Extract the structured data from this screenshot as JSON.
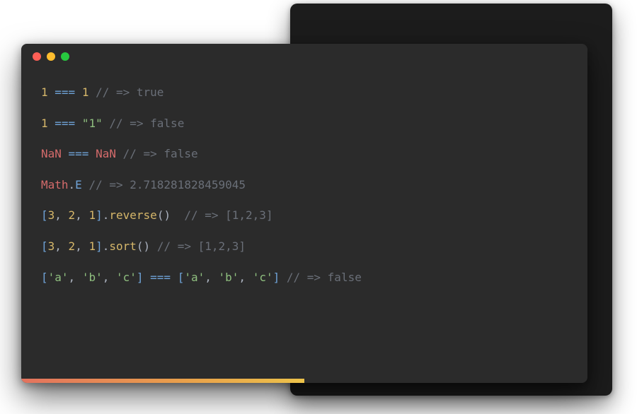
{
  "colors": {
    "editor_bg": "#2b2b2b",
    "back_bg": "#1c1c1c",
    "dot_red": "#ff5f56",
    "dot_yellow": "#ffbd2e",
    "dot_green": "#27c93f"
  },
  "code": {
    "lines": [
      {
        "tokens": [
          {
            "text": "1",
            "cls": "tok-num"
          },
          {
            "text": " === ",
            "cls": "tok-op"
          },
          {
            "text": "1",
            "cls": "tok-num"
          },
          {
            "text": " ",
            "cls": "tok-pun"
          },
          {
            "text": "// => true",
            "cls": "tok-com"
          }
        ]
      },
      {
        "tokens": [
          {
            "text": "1",
            "cls": "tok-num"
          },
          {
            "text": " === ",
            "cls": "tok-op"
          },
          {
            "text": "\"1\"",
            "cls": "tok-str"
          },
          {
            "text": " ",
            "cls": "tok-pun"
          },
          {
            "text": "// => false",
            "cls": "tok-com"
          }
        ]
      },
      {
        "tokens": [
          {
            "text": "NaN",
            "cls": "tok-nan"
          },
          {
            "text": " === ",
            "cls": "tok-op"
          },
          {
            "text": "NaN",
            "cls": "tok-nan"
          },
          {
            "text": " ",
            "cls": "tok-pun"
          },
          {
            "text": "// => false",
            "cls": "tok-com"
          }
        ]
      },
      {
        "tokens": [
          {
            "text": "Math",
            "cls": "tok-obj"
          },
          {
            "text": ".",
            "cls": "tok-pun"
          },
          {
            "text": "E",
            "cls": "tok-prop"
          },
          {
            "text": " ",
            "cls": "tok-pun"
          },
          {
            "text": "// => 2.718281828459045",
            "cls": "tok-com"
          }
        ]
      },
      {
        "tokens": [
          {
            "text": "[",
            "cls": "tok-brk"
          },
          {
            "text": "3",
            "cls": "tok-num"
          },
          {
            "text": ", ",
            "cls": "tok-pun"
          },
          {
            "text": "2",
            "cls": "tok-num"
          },
          {
            "text": ", ",
            "cls": "tok-pun"
          },
          {
            "text": "1",
            "cls": "tok-num"
          },
          {
            "text": "]",
            "cls": "tok-brk"
          },
          {
            "text": ".",
            "cls": "tok-pun"
          },
          {
            "text": "reverse",
            "cls": "tok-fn"
          },
          {
            "text": "()",
            "cls": "tok-pun"
          },
          {
            "text": "  ",
            "cls": "tok-pun"
          },
          {
            "text": "// => [1,2,3]",
            "cls": "tok-com"
          }
        ]
      },
      {
        "tokens": [
          {
            "text": "[",
            "cls": "tok-brk"
          },
          {
            "text": "3",
            "cls": "tok-num"
          },
          {
            "text": ", ",
            "cls": "tok-pun"
          },
          {
            "text": "2",
            "cls": "tok-num"
          },
          {
            "text": ", ",
            "cls": "tok-pun"
          },
          {
            "text": "1",
            "cls": "tok-num"
          },
          {
            "text": "]",
            "cls": "tok-brk"
          },
          {
            "text": ".",
            "cls": "tok-pun"
          },
          {
            "text": "sort",
            "cls": "tok-fn"
          },
          {
            "text": "()",
            "cls": "tok-pun"
          },
          {
            "text": " ",
            "cls": "tok-pun"
          },
          {
            "text": "// => [1,2,3]",
            "cls": "tok-com"
          }
        ]
      },
      {
        "tokens": [
          {
            "text": "[",
            "cls": "tok-brk"
          },
          {
            "text": "'a'",
            "cls": "tok-str"
          },
          {
            "text": ", ",
            "cls": "tok-pun"
          },
          {
            "text": "'b'",
            "cls": "tok-str"
          },
          {
            "text": ", ",
            "cls": "tok-pun"
          },
          {
            "text": "'c'",
            "cls": "tok-str"
          },
          {
            "text": "]",
            "cls": "tok-brk"
          },
          {
            "text": " === ",
            "cls": "tok-op"
          },
          {
            "text": "[",
            "cls": "tok-brk"
          },
          {
            "text": "'a'",
            "cls": "tok-str"
          },
          {
            "text": ", ",
            "cls": "tok-pun"
          },
          {
            "text": "'b'",
            "cls": "tok-str"
          },
          {
            "text": ", ",
            "cls": "tok-pun"
          },
          {
            "text": "'c'",
            "cls": "tok-str"
          },
          {
            "text": "]",
            "cls": "tok-brk"
          },
          {
            "text": " ",
            "cls": "tok-pun"
          },
          {
            "text": "// => false",
            "cls": "tok-com"
          }
        ]
      }
    ]
  }
}
